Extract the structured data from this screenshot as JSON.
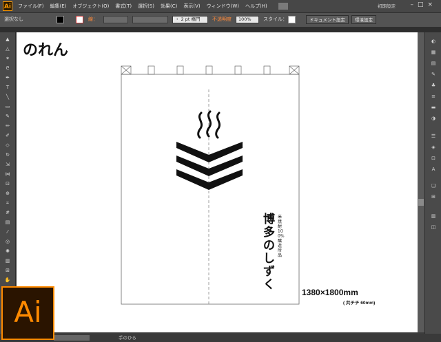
{
  "app": {
    "logo": "Ai",
    "workspace": "初期設定"
  },
  "menu": [
    "ファイル(F)",
    "編集(E)",
    "オブジェクト(O)",
    "書式(T)",
    "選択(S)",
    "効果(C)",
    "表示(V)",
    "ウィンドウ(W)",
    "ヘルプ(H)"
  ],
  "control": {
    "selection": "選択なし",
    "stroke_label": "線：",
    "brush": "・ 2 pt 楕円",
    "opacity_label": "不透明度",
    "opacity_value": "100%",
    "style_label": "スタイル：",
    "doc_setup_button": "ドキュメント設定",
    "prefs_button": "環境設定"
  },
  "status": {
    "tool": "手のひら"
  },
  "artwork": {
    "title": "のれん",
    "size": "1380×1800mm",
    "sub": "( 共チチ 60mm)",
    "brand_main": "博多のしずく",
    "brand_small": "米焼酎100%醸造所品"
  },
  "colors": {
    "accent": "#ff8a00",
    "ink": "#111111"
  }
}
